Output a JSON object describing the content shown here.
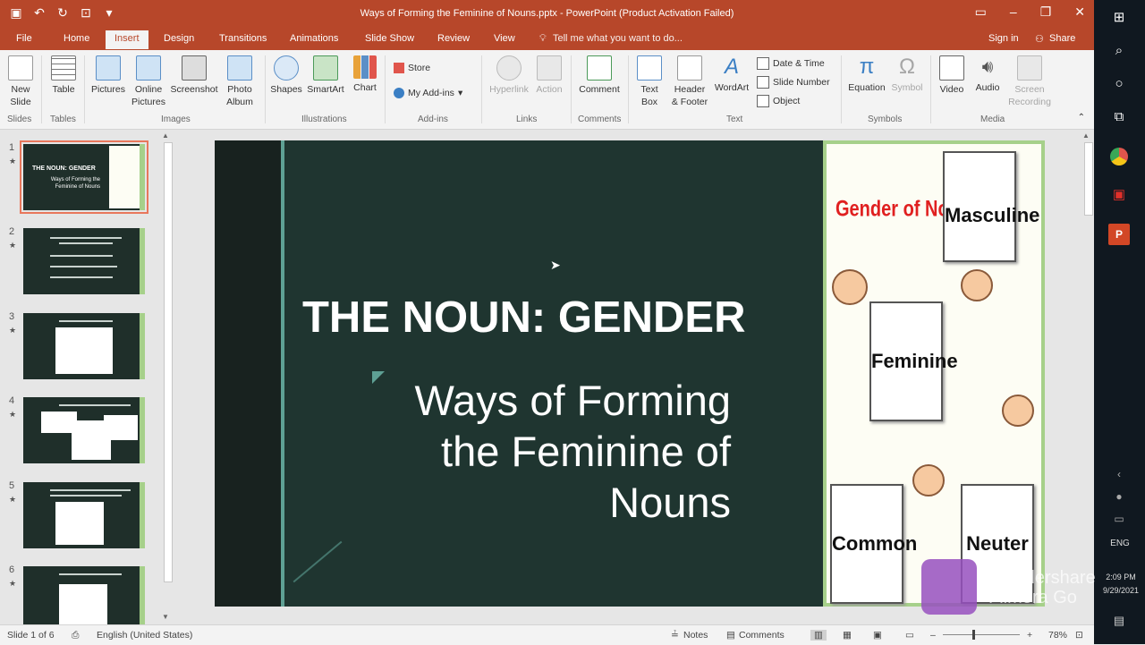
{
  "window": {
    "title": "Ways of Forming the Feminine of Nouns.pptx - PowerPoint (Product Activation Failed)"
  },
  "tabs": [
    "File",
    "Home",
    "Insert",
    "Design",
    "Transitions",
    "Animations",
    "Slide Show",
    "Review",
    "View"
  ],
  "tell_me": "Tell me what you want to do...",
  "signin": "Sign in",
  "share": "Share",
  "ribbon": {
    "new_slide": [
      "New",
      "Slide"
    ],
    "table": "Table",
    "pictures": "Pictures",
    "online_pictures": [
      "Online",
      "Pictures"
    ],
    "screenshot": "Screenshot",
    "photo_album": [
      "Photo",
      "Album"
    ],
    "shapes": "Shapes",
    "smartart": "SmartArt",
    "chart": "Chart",
    "store": "Store",
    "my_addins": "My Add-ins",
    "hyperlink": "Hyperlink",
    "action": "Action",
    "comment": "Comment",
    "text_box": [
      "Text",
      "Box"
    ],
    "header_footer": [
      "Header",
      "& Footer"
    ],
    "wordart": "WordArt",
    "date_time": "Date & Time",
    "slide_number": "Slide Number",
    "object": "Object",
    "equation": "Equation",
    "symbol": "Symbol",
    "video": "Video",
    "audio": "Audio",
    "screen_recording": [
      "Screen",
      "Recording"
    ],
    "groups": {
      "slides": "Slides",
      "tables": "Tables",
      "images": "Images",
      "illustrations": "Illustrations",
      "addins": "Add-ins",
      "links": "Links",
      "comments": "Comments",
      "text": "Text",
      "symbols": "Symbols",
      "media": "Media"
    }
  },
  "thumbnails": [
    "1",
    "2",
    "3",
    "4",
    "5",
    "6"
  ],
  "thumb1_title": "THE NOUN: GENDER",
  "thumb1_sub": "Ways of Forming the Feminine of Nouns",
  "slide": {
    "title": "THE NOUN: GENDER",
    "subtitle_lines": [
      "Ways of Forming",
      "the Feminine of",
      "Nouns"
    ]
  },
  "art": {
    "heading": "Gender of Nouns",
    "cards": [
      "Masculine",
      "Feminine",
      "Common",
      "Neuter"
    ]
  },
  "status": {
    "slide_info": "Slide 1 of 6",
    "language": "English (United States)",
    "notes": "Notes",
    "comments": "Comments",
    "zoom": "78%"
  },
  "taskbar": {
    "lang": "ENG",
    "time": "2:09 PM",
    "date": "9/29/2021"
  },
  "watermark": [
    "Wondershare",
    "Filmora Go"
  ],
  "colors": {
    "accent": "#b7472a",
    "slide_bg": "#1f3530",
    "teal": "#5ea094",
    "green_border": "#a6d08a"
  }
}
